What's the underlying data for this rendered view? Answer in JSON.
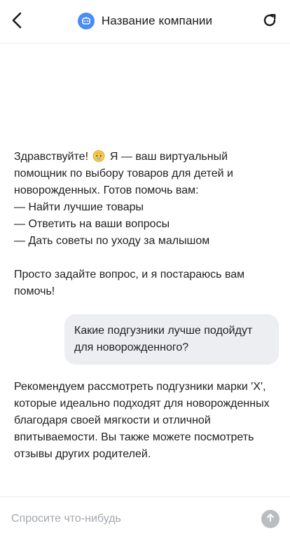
{
  "header": {
    "title": "Название компании",
    "back_icon": "chevron-left-icon",
    "bot_icon": "bot-icon",
    "refresh_icon": "refresh-icon",
    "bot_icon_color": "#4a8cf7"
  },
  "messages": {
    "bot_intro_before_emoji": "Здравствуйте! ",
    "bot_intro_emoji": "baby-emoji",
    "bot_intro_after_emoji": " Я — ваш виртуальный помощник по выбору товаров для детей и новорожденных. Готов помочь вам:\n— Найти лучшие товары\n— Ответить на ваши вопросы\n— Дать советы по уходу за малышом\n\nПросто задайте вопрос, и я постараюсь вам помочь!",
    "user_question": "Какие подгузники лучше подойдут для новорожденного?",
    "bot_answer": "Рекомендуем рассмотреть подгузники марки 'X', которые идеально подходят для новорожденных благодаря своей мягкости и отличной впитываемости. Вы также можете посмотреть отзывы других родителей."
  },
  "composer": {
    "placeholder": "Спросите что-нибудь",
    "value": "",
    "send_icon": "arrow-up-icon",
    "send_button_color": "#b9bcc1"
  },
  "colors": {
    "user_bubble_bg": "#eceef1",
    "text": "#1f1f1f",
    "placeholder": "#a3a7ad"
  }
}
